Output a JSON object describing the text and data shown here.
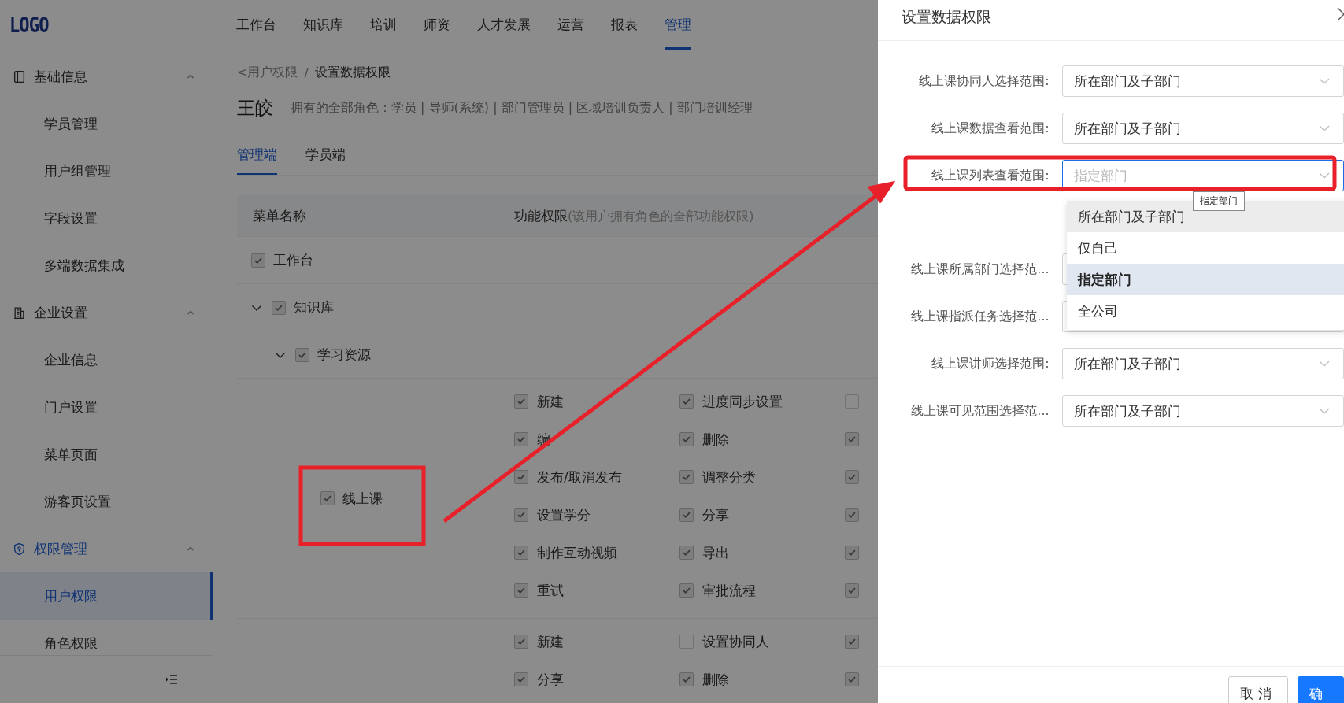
{
  "header": {
    "logo": "LOGO",
    "nav": [
      {
        "label": "工作台",
        "selected": false
      },
      {
        "label": "知识库",
        "selected": false
      },
      {
        "label": "培训",
        "selected": false
      },
      {
        "label": "师资",
        "selected": false
      },
      {
        "label": "人才发展",
        "selected": false
      },
      {
        "label": "运营",
        "selected": false
      },
      {
        "label": "报表",
        "selected": false
      },
      {
        "label": "管理",
        "selected": true
      }
    ]
  },
  "sidebar": {
    "groups": [
      {
        "label": "基础信息",
        "expanded": true,
        "items": [
          {
            "label": "学员管理",
            "selected": false
          },
          {
            "label": "用户组管理",
            "selected": false
          },
          {
            "label": "字段设置",
            "selected": false
          },
          {
            "label": "多端数据集成",
            "selected": false
          }
        ]
      },
      {
        "label": "企业设置",
        "expanded": true,
        "items": [
          {
            "label": "企业信息",
            "selected": false
          },
          {
            "label": "门户设置",
            "selected": false
          },
          {
            "label": "菜单页面",
            "selected": false
          },
          {
            "label": "游客页设置",
            "selected": false
          }
        ]
      },
      {
        "label": "权限管理",
        "expanded": true,
        "items": [
          {
            "label": "用户权限",
            "selected": true
          },
          {
            "label": "角色权限",
            "selected": false
          }
        ]
      }
    ]
  },
  "breadcrumb": {
    "back": "<用户权限",
    "separator": "/",
    "current": "设置数据权限"
  },
  "user": {
    "name": "王皎",
    "roles": "拥有的全部角色：学员 | 导师(系统) | 部门管理员 | 区域培训负责人 | 部门培训经理"
  },
  "tabs": [
    {
      "label": "管理端",
      "selected": true
    },
    {
      "label": "学员端",
      "selected": false
    }
  ],
  "table": {
    "columns": [
      {
        "label": "菜单名称"
      },
      {
        "label": "功能权限",
        "note": "(该用户拥有角色的全部功能权限)"
      }
    ],
    "rows": [
      {
        "label": "工作台",
        "checked": true
      },
      {
        "label": "知识库",
        "checked": true,
        "expanded": true,
        "children": [
          {
            "label": "学习资源",
            "checked": true,
            "expanded": true,
            "children": [
              {
                "label": "线上课",
                "checked": true,
                "permissions": [
                  {
                    "label": "新建",
                    "checked": true
                  },
                  {
                    "label": "进度同步设置",
                    "checked": true
                  },
                  {
                    "checked": false
                  },
                  {
                    "label": "编",
                    "checked": true
                  },
                  {
                    "label": "删除",
                    "checked": true
                  },
                  {
                    "checked": true
                  },
                  {
                    "label": "发布/取消发布",
                    "checked": true
                  },
                  {
                    "label": "调整分类",
                    "checked": true
                  },
                  {
                    "checked": true
                  },
                  {
                    "label": "设置学分",
                    "checked": true
                  },
                  {
                    "label": "分享",
                    "checked": true
                  },
                  {
                    "checked": true
                  },
                  {
                    "label": "制作互动视频",
                    "checked": true
                  },
                  {
                    "label": "导出",
                    "checked": true
                  },
                  {
                    "checked": true
                  },
                  {
                    "label": "重试",
                    "checked": true
                  },
                  {
                    "label": "审批流程",
                    "checked": true
                  },
                  {
                    "checked": true
                  }
                ]
              },
              {
                "permissions": [
                  {
                    "label": "新建",
                    "checked": true
                  },
                  {
                    "label": "设置协同人",
                    "checked": false
                  },
                  {
                    "checked": true
                  },
                  {
                    "label": "分享",
                    "checked": true
                  },
                  {
                    "label": "删除",
                    "checked": true
                  },
                  {
                    "checked": true
                  }
                ]
              }
            ]
          }
        ]
      }
    ]
  },
  "drawer": {
    "title": "设置数据权限",
    "fields": [
      {
        "label": "线上课协同人选择范围:",
        "value": "所在部门及子部门",
        "open": false
      },
      {
        "label": "线上课数据查看范围:",
        "value": "所在部门及子部门",
        "open": false
      },
      {
        "label": "线上课列表查看范围:",
        "placeholder": "指定部门",
        "open": true,
        "tooltip": "指定部门",
        "options": [
          {
            "label": "所在部门及子部门",
            "selected": false,
            "hovered": true
          },
          {
            "label": "仅自己",
            "selected": false,
            "hovered": false
          },
          {
            "label": "指定部门",
            "selected": true,
            "hovered": false
          },
          {
            "label": "全公司",
            "selected": false,
            "hovered": false
          }
        ]
      },
      {
        "label": "线上课所属部门选择范...",
        "open": false
      },
      {
        "label": "线上课指派任务选择范...",
        "open": false
      },
      {
        "label": "线上课讲师选择范围:",
        "value": "所在部门及子部门",
        "open": false
      },
      {
        "label": "线上课可见范围选择范...",
        "value": "所在部门及子部门",
        "open": false
      }
    ],
    "buttons": [
      {
        "label": "取消",
        "kind": "default"
      },
      {
        "label": "确",
        "kind": "primary"
      }
    ]
  }
}
